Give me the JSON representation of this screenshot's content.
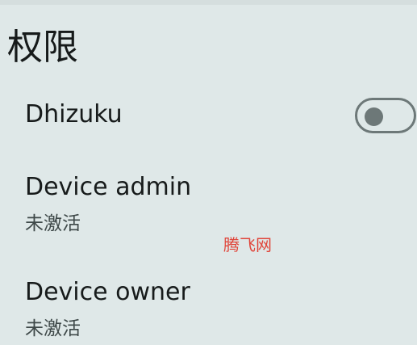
{
  "page": {
    "title": "权限"
  },
  "settings": {
    "dhizuku": {
      "title": "Dhizuku",
      "toggle_on": false
    },
    "device_admin": {
      "title": "Device admin",
      "summary": "未激活"
    },
    "device_owner": {
      "title": "Device owner",
      "summary": "未激活"
    }
  },
  "watermark": {
    "text": "腾飞网",
    "color": "#e0453a"
  },
  "colors": {
    "background": "#dfe8e8",
    "toggle_off": "#6d7878"
  }
}
